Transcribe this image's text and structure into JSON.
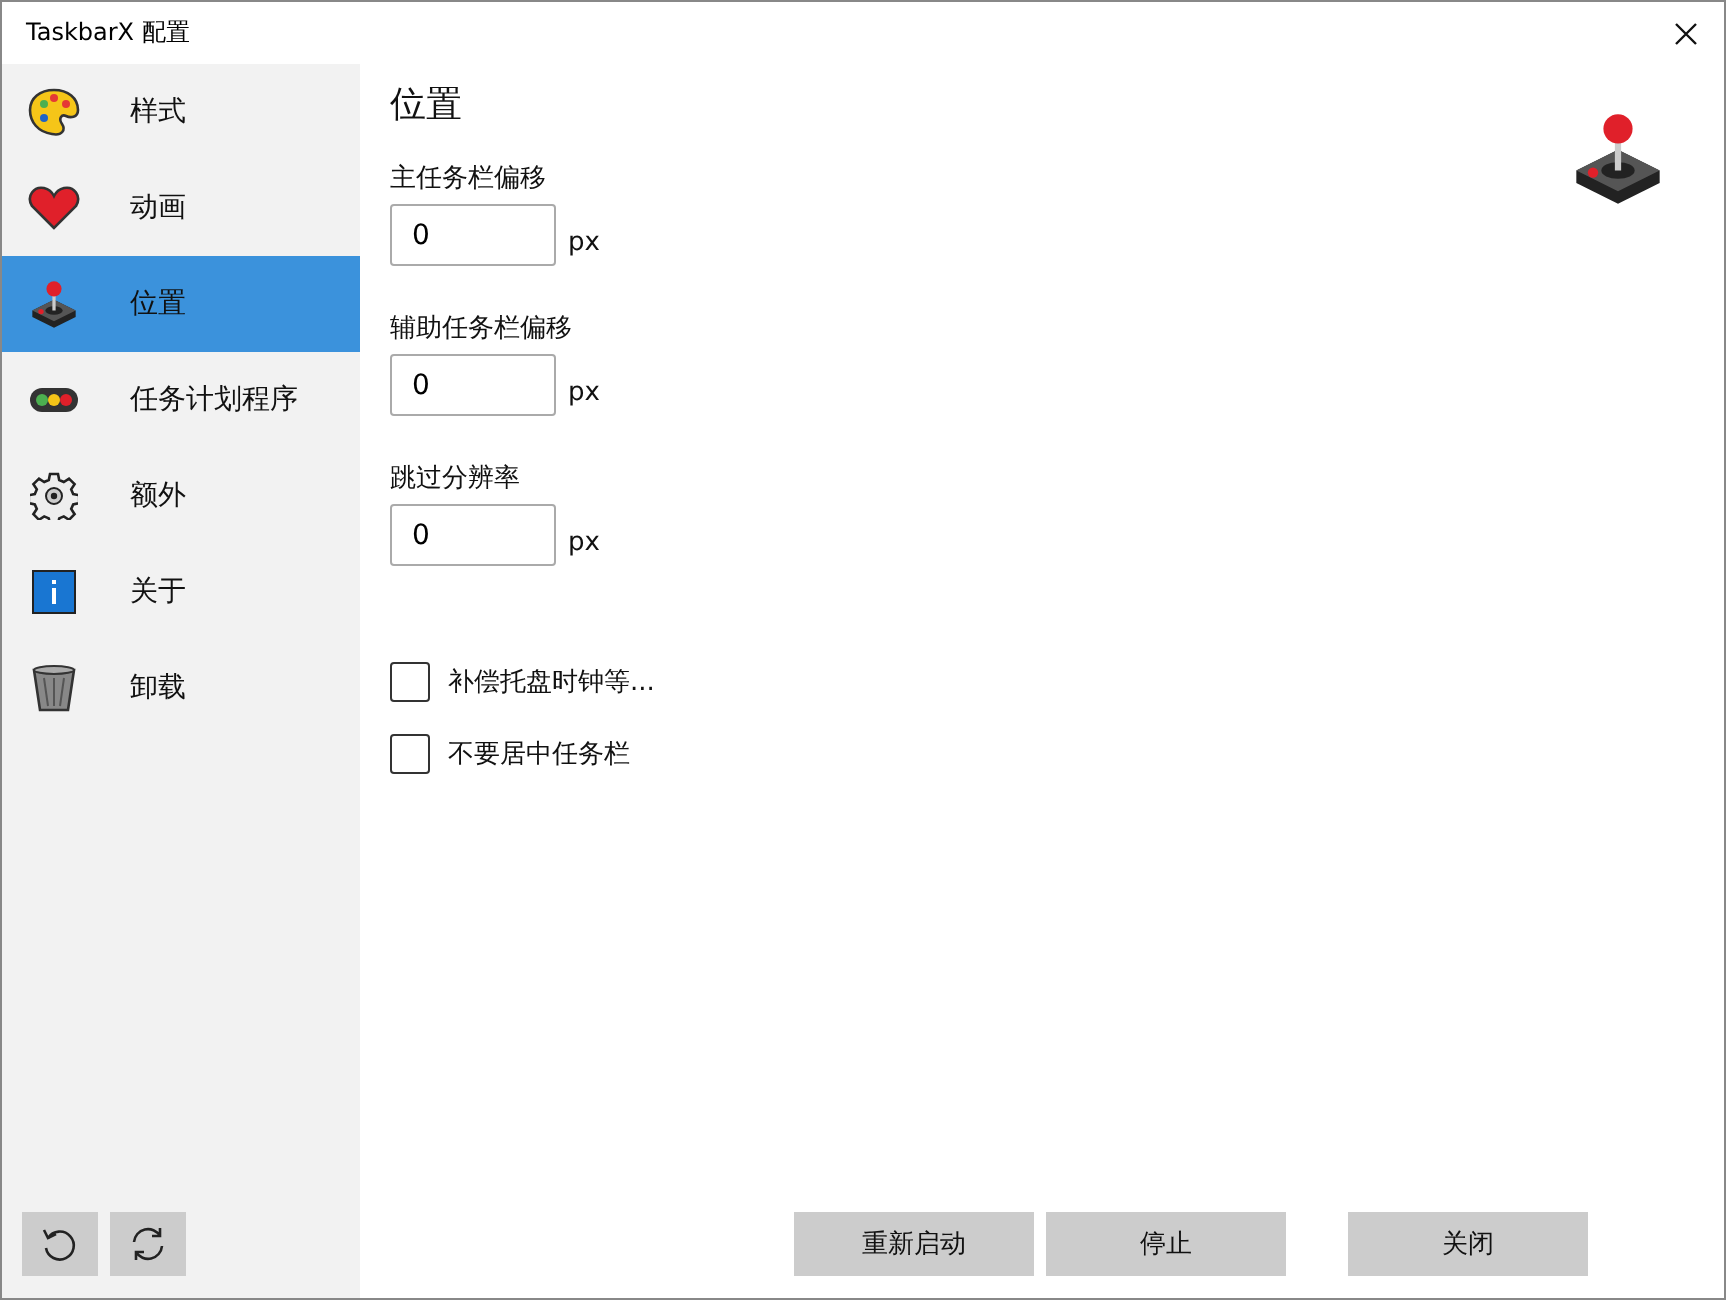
{
  "window": {
    "title": "TaskbarX 配置"
  },
  "sidebar": {
    "items": [
      {
        "label": "样式",
        "selected": false
      },
      {
        "label": "动画",
        "selected": false
      },
      {
        "label": "位置",
        "selected": true
      },
      {
        "label": "任务计划程序",
        "selected": false
      },
      {
        "label": "额外",
        "selected": false
      },
      {
        "label": "关于",
        "selected": false
      },
      {
        "label": "卸载",
        "selected": false
      }
    ]
  },
  "page": {
    "heading": "位置",
    "fields": [
      {
        "label": "主任务栏偏移",
        "value": "0",
        "unit": "px"
      },
      {
        "label": "辅助任务栏偏移",
        "value": "0",
        "unit": "px"
      },
      {
        "label": "跳过分辨率",
        "value": "0",
        "unit": "px"
      }
    ],
    "checkboxes": [
      {
        "label": "补偿托盘时钟等...",
        "checked": false
      },
      {
        "label": "不要居中任务栏",
        "checked": false
      }
    ]
  },
  "buttons": [
    "重新启动",
    "停止",
    "关闭"
  ]
}
